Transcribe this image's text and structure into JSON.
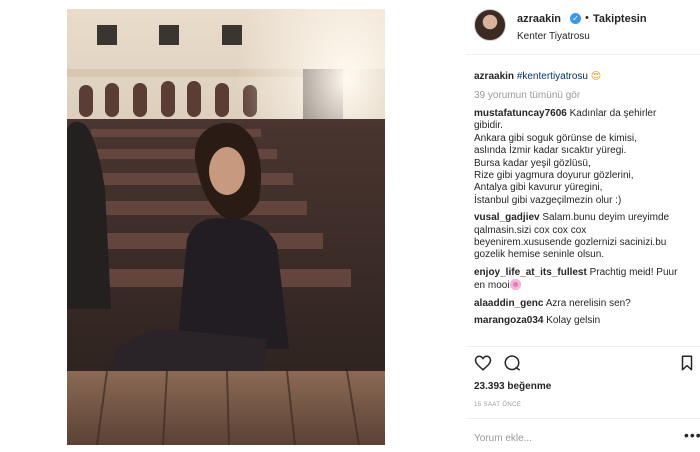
{
  "post": {
    "username": "azraakin",
    "verified_icon": "check-icon",
    "follow_dot": "•",
    "follow_status": "Takiptesin",
    "location": "Kenter Tiyatrosu",
    "caption": {
      "username": "azraakin",
      "hashtag": "#kentertiyatrosu",
      "emoji": "heart-eyes-emoji"
    },
    "view_all_comments": "39 yorumun tümünü gör",
    "comments": [
      {
        "username": "mustafatuncay7606",
        "lines": [
          "Kadınlar da şehirler",
          "gibidir.",
          "Ankara gibi soguk görünse de kimisi,",
          "aslında İzmir kadar sıcaktır yüregi.",
          "Bursa kadar yeşil gözlüsü,",
          "Rize gibi yagmura doyurur gözlerini,",
          "Antalya gibi kavurur yüregini,",
          "İstanbul gibi vazgeçilmezin olur :)"
        ]
      },
      {
        "username": "vusal_gadjiev",
        "lines": [
          "Salam.bunu deyim ureyimde",
          "qalmasin.sizi cox cox cox",
          "beyenirem.xususende gozlernizi sacinizi.bu",
          "gozelik hemise seninle olsun."
        ]
      },
      {
        "username": "enjoy_life_at_its_fullest",
        "lines": [
          "Prachtig meid! Puur",
          "en mooi"
        ]
      },
      {
        "username": "alaaddin_genc",
        "lines": [
          "Azra nerelisin sen?"
        ]
      },
      {
        "username": "marangoza034",
        "lines": [
          "Kolay gelsin"
        ]
      }
    ],
    "likes": "23.393 beğenme",
    "timestamp": "15 SAAT ÖNCE",
    "comment_placeholder": "Yorum ekle...",
    "more_options": "•••"
  },
  "colors": {
    "link": "#003569",
    "muted": "#999999",
    "text": "#262626",
    "verified": "#3897f0"
  }
}
